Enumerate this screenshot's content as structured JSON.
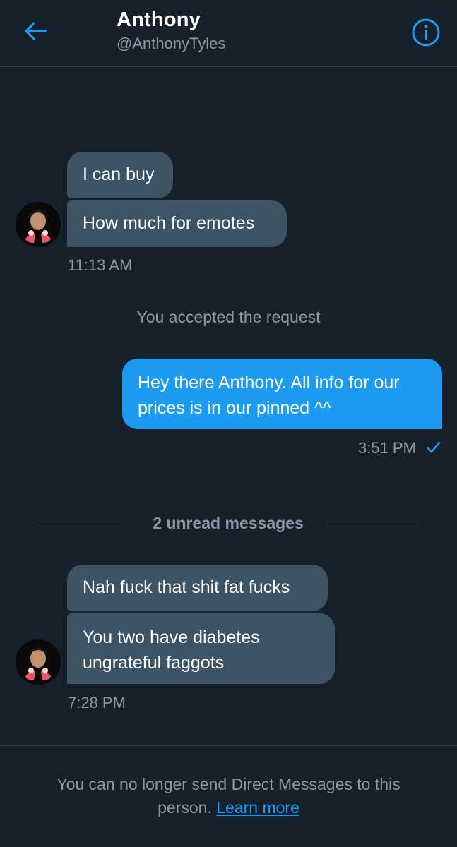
{
  "header": {
    "title": "Anthony",
    "handle": "@AnthonyTyles",
    "back_icon": "arrow-left-icon",
    "info_icon": "info-circle-icon"
  },
  "thread": {
    "group1": {
      "messages": [
        "I can buy",
        "How much for emotes"
      ],
      "time": "11:13 AM"
    },
    "system_notice": "You accepted the request",
    "sent": {
      "text": "Hey there Anthony. All info for our prices is in our pinned ^^",
      "time": "3:51 PM",
      "status_icon": "checkmark-icon"
    },
    "unread_divider": "2 unread messages",
    "group2": {
      "messages": [
        "Nah fuck that shit fat fucks",
        "You two have diabetes ungrateful faggots"
      ],
      "time": "7:28 PM"
    }
  },
  "footer": {
    "text": "You can no longer send Direct Messages to this person.",
    "link": "Learn more"
  },
  "colors": {
    "background": "#15202b",
    "accent": "#1d9bf0",
    "incoming_bubble": "#3d5466",
    "muted_text": "#8b98a5"
  }
}
